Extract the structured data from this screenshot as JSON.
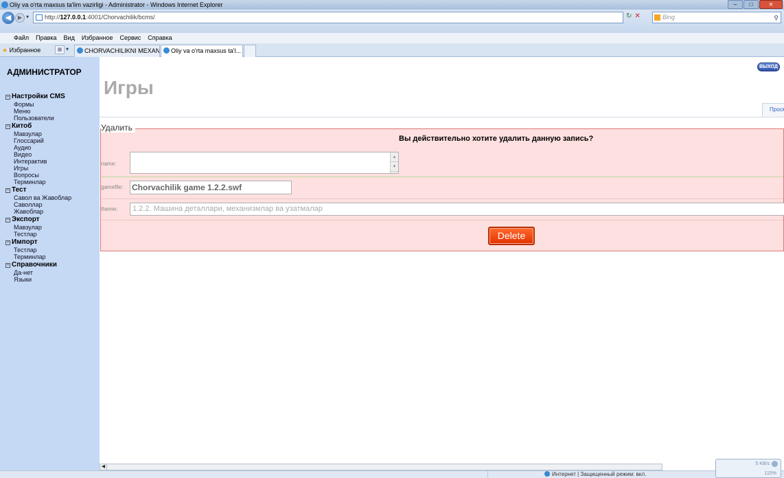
{
  "browser": {
    "window_title": "Oliy va o'rta maxsus ta'lim vazirligi - Administrator - Windows Internet Explorer",
    "url_prefix": "http://",
    "url_host": "127.0.0.1",
    "url_path": ":4001/Chorvachilik/bcms/",
    "search_placeholder": "Bing",
    "menu": [
      "Файл",
      "Правка",
      "Вид",
      "Избранное",
      "Сервис",
      "Справка"
    ],
    "favorites_label": "Избранное",
    "tabs": [
      {
        "label": "CHORVACHILIKNI MEXAN...",
        "active": false
      },
      {
        "label": "Oliy va o'rta maxsus ta'l...",
        "active": true
      }
    ],
    "status": "Интернет | Защищенный режим: вкл.",
    "net_speed": "5 KB/s",
    "zoom": "115%"
  },
  "sidebar": {
    "title": "АДМИНИСТРАТОР",
    "sections": [
      {
        "label": "Настройки CMS",
        "items": [
          "Формы",
          "Меню",
          "Пользователи"
        ]
      },
      {
        "label": "Китоб",
        "items": [
          "Мавзулар",
          "Глоссарий",
          "Аудио",
          "Видео",
          "Интерактив",
          "Игры",
          "Вопросы",
          "Терминлар"
        ]
      },
      {
        "label": "Тест",
        "items": [
          "Савол ва Жавоблар",
          "Саволлар",
          "Жавоблар"
        ]
      },
      {
        "label": "Экспорт",
        "items": [
          "Мавзулар",
          "Тестлар"
        ]
      },
      {
        "label": "Импорт",
        "items": [
          "Тестлар",
          "Терминлар"
        ]
      },
      {
        "label": "Справочники",
        "items": [
          "Да-нет",
          "Языки"
        ]
      }
    ]
  },
  "page": {
    "exit_label": "ВЫХОД",
    "title": "Игры",
    "view_tab": "Просм",
    "form": {
      "legend": "Удалить",
      "confirm_text": "Вы действительно хотите удалить данную запись?",
      "name_label": "name:",
      "name_value": "",
      "gamefile_label": "gamefile:",
      "gamefile_value": "Chorvachilik game 1.2.2.swf",
      "theme_label": "theme:",
      "theme_value": "1.2.2. Машина деталлари, механизмлар ва узатмалар",
      "delete_label": "Delete"
    }
  },
  "colors": {
    "sidebar_bg": "#c5d9f5",
    "panel_bg": "#fde0df",
    "panel_border": "#d97a79",
    "delete_button": "#e33200"
  }
}
